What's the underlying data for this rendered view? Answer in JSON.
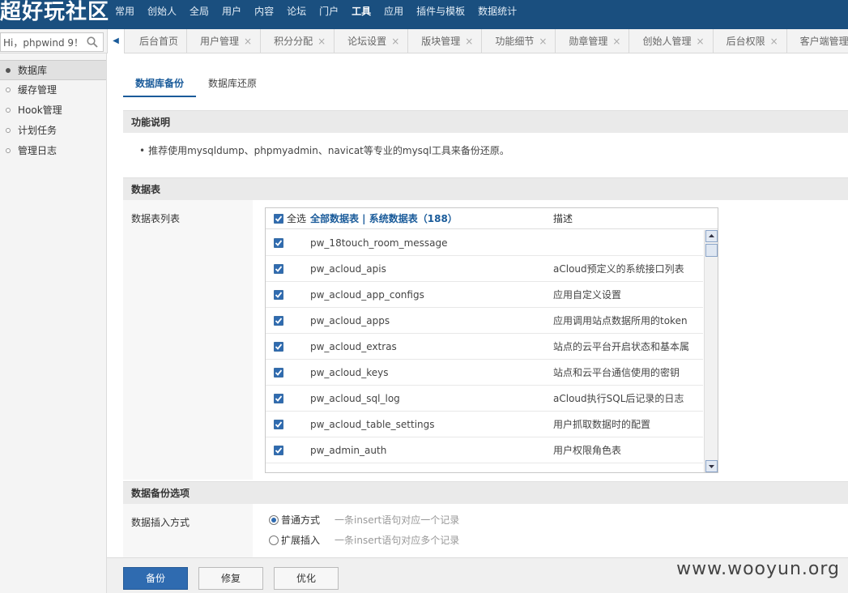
{
  "header": {
    "logo_text": "超好玩社区",
    "nav": [
      {
        "label": "常用"
      },
      {
        "label": "创始人"
      },
      {
        "label": "全局"
      },
      {
        "label": "用户"
      },
      {
        "label": "内容"
      },
      {
        "label": "论坛"
      },
      {
        "label": "门户"
      },
      {
        "label": "工具",
        "active": true
      },
      {
        "label": "应用"
      },
      {
        "label": "插件与模板"
      },
      {
        "label": "数据统计"
      }
    ]
  },
  "search": {
    "value": "Hi，phpwind 9！"
  },
  "tabs": [
    {
      "label": "后台首页",
      "closable": false
    },
    {
      "label": "用户管理",
      "closable": true
    },
    {
      "label": "积分分配",
      "closable": true
    },
    {
      "label": "论坛设置",
      "closable": true
    },
    {
      "label": "版块管理",
      "closable": true
    },
    {
      "label": "功能细节",
      "closable": true
    },
    {
      "label": "勋章管理",
      "closable": true
    },
    {
      "label": "创始人管理",
      "closable": true
    },
    {
      "label": "后台权限",
      "closable": true
    },
    {
      "label": "客户端管理",
      "closable": false
    }
  ],
  "tab_close_glyph": "×",
  "sidebar": {
    "items": [
      {
        "label": "数据库",
        "active": true
      },
      {
        "label": "缓存管理"
      },
      {
        "label": "Hook管理"
      },
      {
        "label": "计划任务"
      },
      {
        "label": "管理日志"
      }
    ]
  },
  "subtabs": [
    {
      "label": "数据库备份",
      "active": true
    },
    {
      "label": "数据库还原"
    }
  ],
  "sections": {
    "intro": {
      "title": "功能说明",
      "bullet": "•",
      "text": "推荐使用mysqldump、phpmyadmin、navicat等专业的mysql工具来备份还原。"
    },
    "tables": {
      "title": "数据表",
      "row_label": "数据表列表",
      "select_all_label": "全选",
      "filter_text": "全部数据表 | 系统数据表（188）",
      "desc_header": "描述",
      "rows": [
        {
          "name": "pw_18touch_room_message",
          "desc": ""
        },
        {
          "name": "pw_acloud_apis",
          "desc": "aCloud预定义的系统接口列表"
        },
        {
          "name": "pw_acloud_app_configs",
          "desc": "应用自定义设置"
        },
        {
          "name": "pw_acloud_apps",
          "desc": "应用调用站点数据所用的token"
        },
        {
          "name": "pw_acloud_extras",
          "desc": "站点的云平台开启状态和基本属"
        },
        {
          "name": "pw_acloud_keys",
          "desc": "站点和云平台通信使用的密钥"
        },
        {
          "name": "pw_acloud_sql_log",
          "desc": "aCloud执行SQL后记录的日志"
        },
        {
          "name": "pw_acloud_table_settings",
          "desc": "用户抓取数据时的配置"
        },
        {
          "name": "pw_admin_auth",
          "desc": "用户权限角色表"
        }
      ]
    },
    "options": {
      "title": "数据备份选项",
      "row_label": "数据插入方式",
      "radios": [
        {
          "label": "普通方式",
          "hint": "一条insert语句对应一个记录",
          "checked": true
        },
        {
          "label": "扩展插入",
          "hint": "一条insert语句对应多个记录",
          "checked": false
        }
      ]
    }
  },
  "footer": {
    "backup_label": "备份",
    "repair_label": "修复",
    "optimize_label": "优化"
  },
  "watermark": "www.wooyun.org",
  "colors": {
    "header_bg": "#1a4f7f",
    "accent": "#2f6bb0",
    "link": "#1a5b9a"
  }
}
